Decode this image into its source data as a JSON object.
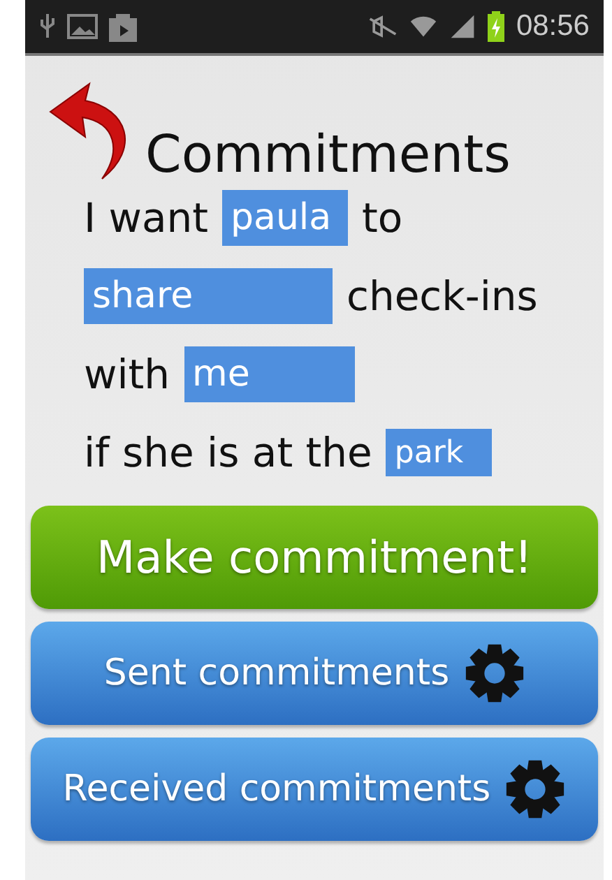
{
  "status_bar": {
    "time": "08:56"
  },
  "title": "Commitments",
  "sentence": [
    [
      {
        "kind": "text",
        "text": "I want"
      },
      {
        "kind": "field",
        "value": "paula"
      },
      {
        "kind": "text",
        "text": "to"
      }
    ],
    [
      {
        "kind": "field",
        "value": "share"
      },
      {
        "kind": "text",
        "text": "check-ins"
      }
    ],
    [
      {
        "kind": "text",
        "text": "with"
      },
      {
        "kind": "field",
        "value": "me"
      }
    ],
    [
      {
        "kind": "text",
        "text": "if she is at the"
      },
      {
        "kind": "field",
        "value": "park"
      }
    ]
  ],
  "buttons": [
    {
      "kind": "primary",
      "label": "Make commitment!"
    },
    {
      "kind": "list",
      "label": "Sent commitments"
    },
    {
      "kind": "list",
      "label": "Received commitments"
    }
  ]
}
